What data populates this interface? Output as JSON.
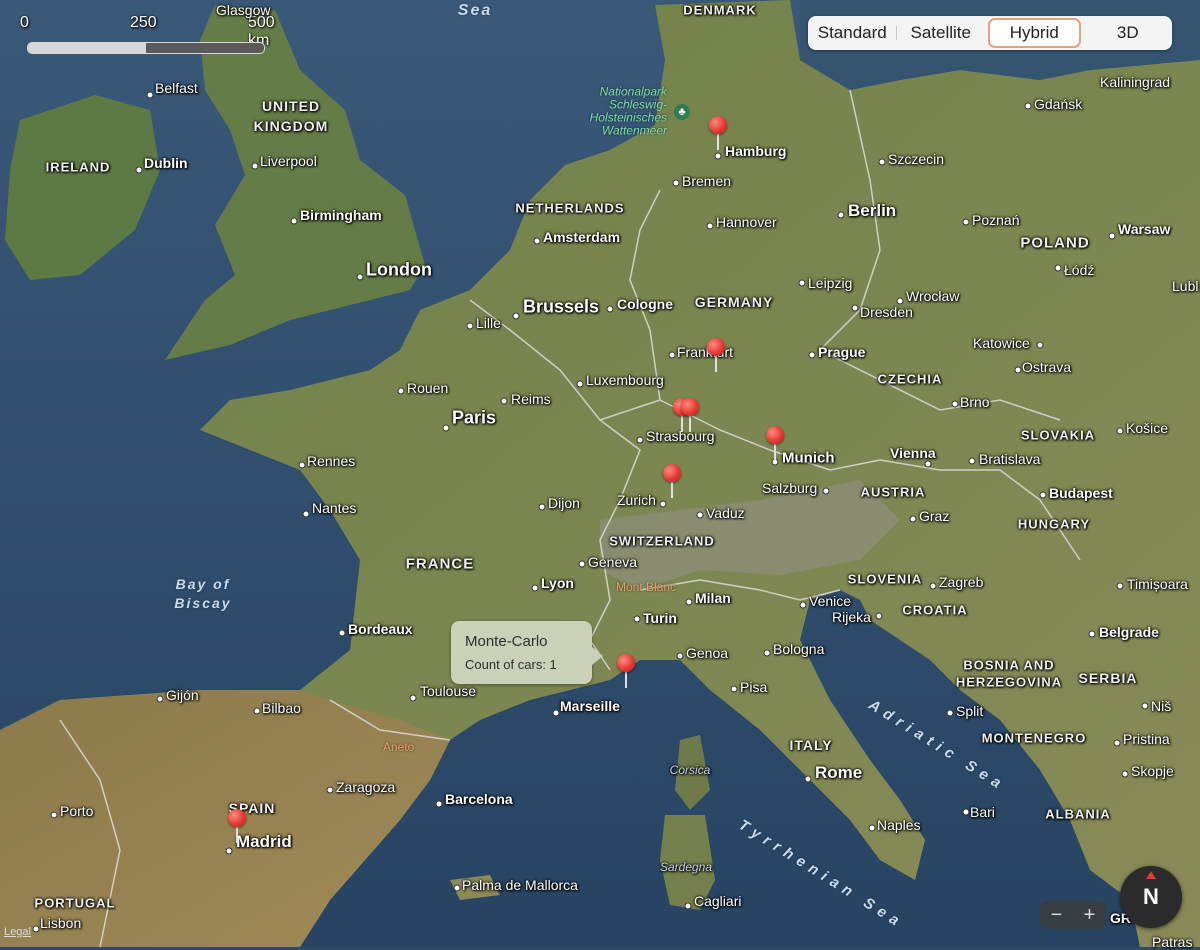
{
  "map_type": {
    "options": [
      "Standard",
      "Satellite",
      "Hybrid",
      "3D"
    ],
    "selected": "Hybrid"
  },
  "scale": {
    "ticks": [
      "0",
      "250",
      "500 km"
    ]
  },
  "tooltip": {
    "title": "Monte-Carlo",
    "subtitle": "Count of cars: 1"
  },
  "zoom": {
    "minus": "−",
    "plus": "+"
  },
  "compass": {
    "label": "N"
  },
  "legal": "Legal",
  "labels": {
    "glasgow": "Glasgow",
    "denmark": "DENMARK",
    "sea_top": "Sea",
    "belfast": "Belfast",
    "united_kingdom_1": "UNITED",
    "united_kingdom_2": "KINGDOM",
    "ireland": "IRELAND",
    "dublin": "Dublin",
    "liverpool": "Liverpool",
    "birmingham": "Birmingham",
    "london": "London",
    "park_1": "Nationalpark",
    "park_2": "Schleswig-",
    "park_3": "Holsteinisches",
    "park_4": "Wattenmeer",
    "hamburg": "Hamburg",
    "kaliningrad": "Kaliningrad",
    "gdansk": "Gdańsk",
    "szczecin": "Szczecin",
    "bremen": "Bremen",
    "netherlands": "NETHERLANDS",
    "amsterdam": "Amsterdam",
    "hannover": "Hannover",
    "berlin": "Berlin",
    "poznan": "Poznań",
    "warsaw": "Warsaw",
    "poland": "POLAND",
    "lodz": "Łódź",
    "lublin": "Lubl",
    "brussels": "Brussels",
    "cologne": "Cologne",
    "germany": "GERMANY",
    "leipzig": "Leipzig",
    "wroclaw": "Wrocław",
    "dresden": "Dresden",
    "lille": "Lille",
    "frankfurt": "Frankfurt",
    "prague": "Prague",
    "katowice": "Katowice",
    "ostrava": "Ostrava",
    "luxembourg": "Luxembourg",
    "rouen": "Rouen",
    "czechia": "CZECHIA",
    "reims": "Reims",
    "paris": "Paris",
    "brno": "Brno",
    "strasbourg": "Strasbourg",
    "slovakia": "SLOVAKIA",
    "kosice": "Košice",
    "rennes": "Rennes",
    "munich": "Munich",
    "vienna": "Vienna",
    "bratislava": "Bratislava",
    "salzburg": "Salzburg",
    "austria": "AUSTRIA",
    "budapest": "Budapest",
    "dijon": "Dijon",
    "zurich": "Zurich",
    "nantes": "Nantes",
    "vaduz": "Vaduz",
    "graz": "Graz",
    "hungary": "HUNGARY",
    "switzerland": "SWITZERLAND",
    "geneva": "Geneva",
    "france": "FRANCE",
    "bay_1": "Bay of",
    "bay_2": "Biscay",
    "lyon": "Lyon",
    "mont_blanc": "Mont Blanc",
    "milan": "Milan",
    "slovenia": "SLOVENIA",
    "zagreb": "Zagreb",
    "timisoara": "Timișoara",
    "venice": "Venice",
    "croatia": "CROATIA",
    "turin": "Turin",
    "rijeka": "Rijeka",
    "bordeaux": "Bordeaux",
    "belgrade": "Belgrade",
    "genoa": "Genoa",
    "bologna": "Bologna",
    "bosnia_1": "BOSNIA AND",
    "bosnia_2": "HERZEGOVINA",
    "serbia": "SERBIA",
    "gijon": "Gijón",
    "toulouse": "Toulouse",
    "pisa": "Pisa",
    "bilbao": "Bilbao",
    "marseille": "Marseille",
    "split": "Split",
    "nis": "Niš",
    "adriatic": "Adriatic Sea",
    "aneto": "Aneto",
    "italy": "ITALY",
    "montenegro": "MONTENEGRO",
    "pristina": "Pristina",
    "corsica": "Corsica",
    "rome": "Rome",
    "skopje": "Skopje",
    "zaragoza": "Zaragoza",
    "porto": "Porto",
    "spain": "SPAIN",
    "barcelona": "Barcelona",
    "bari": "Bari",
    "albania": "ALBANIA",
    "madrid": "Madrid",
    "tyrrhenian": "Tyrrhenian Sea",
    "naples": "Naples",
    "sardegna": "Sardegna",
    "palma": "Palma de Mallorca",
    "portugal": "PORTUGAL",
    "cagliari": "Cagliari",
    "lisbon": "Lisbon",
    "patras": "Patras",
    "greece": "GR"
  },
  "pins": [
    "hamburg",
    "frankfurt",
    "strasbourg-1",
    "strasbourg-2",
    "munich",
    "zurich",
    "monte-carlo",
    "madrid"
  ]
}
